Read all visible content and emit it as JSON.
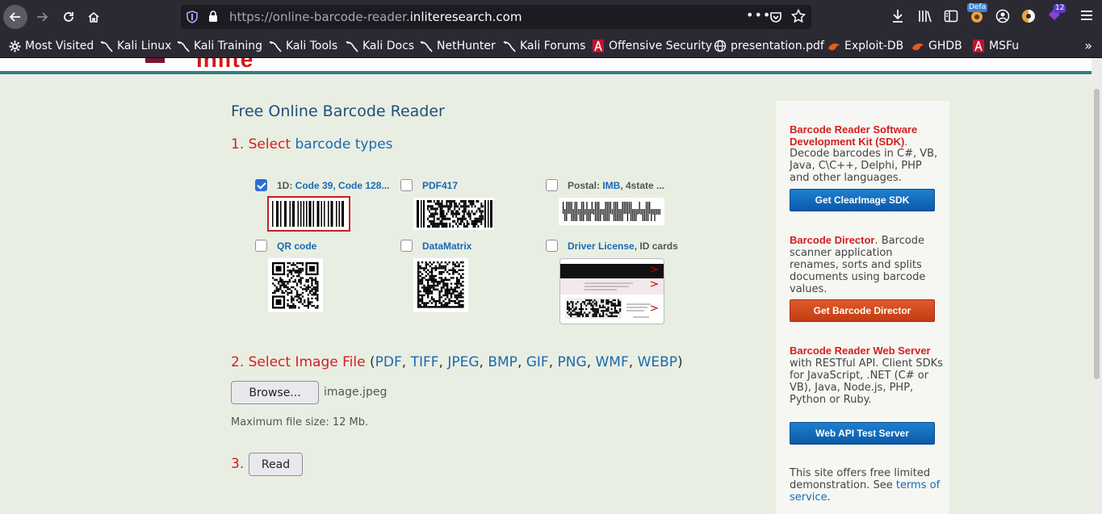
{
  "browser": {
    "url_prefix": "https://online-barcode-reader.",
    "url_domain": "inliteresearch.com",
    "badge_default": "Defa",
    "badge_count": "12",
    "bookmarks": [
      {
        "label": "Most Visited",
        "icon": "gear-icon"
      },
      {
        "label": "Kali Linux",
        "icon": "kali-dragon-icon"
      },
      {
        "label": "Kali Training",
        "icon": "kali-dragon-icon"
      },
      {
        "label": "Kali Tools",
        "icon": "kali-dragon-icon"
      },
      {
        "label": "Kali Docs",
        "icon": "kali-dragon-icon"
      },
      {
        "label": "NetHunter",
        "icon": "kali-dragon-icon"
      },
      {
        "label": "Kali Forums",
        "icon": "kali-dragon-icon"
      },
      {
        "label": "Offensive Security",
        "icon": "offsec-icon"
      },
      {
        "label": "presentation.pdf",
        "icon": "globe-icon"
      },
      {
        "label": "Exploit-DB",
        "icon": "exploitdb-icon"
      },
      {
        "label": "GHDB",
        "icon": "exploitdb-icon"
      },
      {
        "label": "MSFu",
        "icon": "offsec-icon"
      }
    ]
  },
  "header": {
    "logo_text": "inlite"
  },
  "main": {
    "title": "Free Online Barcode Reader",
    "step1": {
      "num": "1. Select",
      "link": "barcode types"
    },
    "barcodes": [
      {
        "prefix": "1D: ",
        "link": "Code 39, Code 128...",
        "suffix": "",
        "checked": true
      },
      {
        "prefix": "",
        "link": "PDF417",
        "suffix": "",
        "checked": false
      },
      {
        "prefix": "Postal: ",
        "link": "IMB",
        "suffix": ", 4state ...",
        "checked": false
      },
      {
        "prefix": "",
        "link": "QR code",
        "suffix": "",
        "checked": false
      },
      {
        "prefix": "",
        "link": "DataMatrix",
        "suffix": "",
        "checked": false
      },
      {
        "prefix": "",
        "link": "Driver License",
        "suffix": ", ID cards",
        "checked": false
      }
    ],
    "step2": {
      "text": "2. Select Image File",
      "open": "(",
      "formats": [
        "PDF",
        "TIFF",
        "JPEG",
        "BMP",
        "GIF",
        "PNG",
        "WMF",
        "WEBP"
      ],
      "sep": ", ",
      "close": ")"
    },
    "browse_label": "Browse...",
    "filename": "image.jpeg",
    "max_size": "Maximum file size: 12 Mb.",
    "step3": "3.",
    "read_label": "Read"
  },
  "sidebar": {
    "sdk": {
      "title": "Barcode Reader Software Development Kit (SDK)",
      "text": "Decode barcodes in C#, VB, Java, C\\C++, Delphi, PHP and other languages.",
      "button": "Get ClearImage SDK"
    },
    "director": {
      "title": "Barcode Director",
      "text": ". Barcode scanner application renames, sorts and splits documents using barcode values.",
      "button": "Get Barcode Director"
    },
    "webserver": {
      "title": "Barcode Reader Web Server",
      "text": " with RESTful API. Client SDKs for JavaScript, .NET (C# or VB), Java, Node.js, PHP, Python or Ruby.",
      "button": "Web API Test Server"
    },
    "footer": {
      "text": "This site offers free limited demonstration. See ",
      "link": "terms of service",
      "end": "."
    }
  }
}
